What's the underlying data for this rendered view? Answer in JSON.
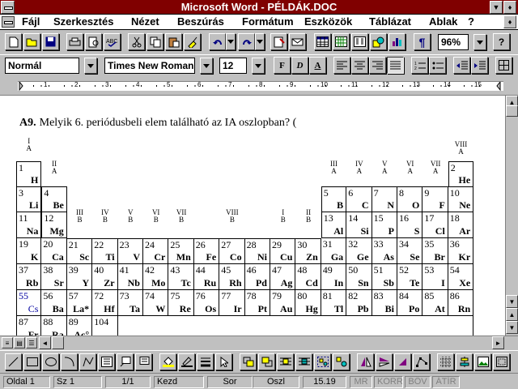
{
  "window": {
    "title": "Microsoft Word - PÉLDÁK.DOC"
  },
  "menu": [
    "Fájl",
    "Szerkesztés",
    "Nézet",
    "Beszúrás",
    "Formátum",
    "Eszközök",
    "Táblázat",
    "Ablak",
    "?"
  ],
  "toolbar": {
    "zoom": "96%"
  },
  "format": {
    "style": "Normál",
    "font": "Times New Roman",
    "size": "12",
    "bold": "F",
    "italic": "D",
    "underline": "A"
  },
  "ruler": {
    "labels": [
      "1",
      "2",
      "3",
      "4",
      "5",
      "6",
      "7",
      "8",
      "9",
      "10",
      "11",
      "12",
      "13",
      "14",
      "15"
    ]
  },
  "document": {
    "question_number": "A9.",
    "question_text": "Melyik  6. periódusbeli elem található az IA oszlopban? (",
    "group_labels": [
      {
        "top": "I",
        "bottom": "A"
      },
      {
        "top": "II",
        "bottom": "A"
      },
      {
        "top": "III",
        "bottom": "B"
      },
      {
        "top": "IV",
        "bottom": "B"
      },
      {
        "top": "V",
        "bottom": "B"
      },
      {
        "top": "VI",
        "bottom": "B"
      },
      {
        "top": "VII",
        "bottom": "B"
      },
      {
        "top": "VIII",
        "bottom": "B"
      },
      {
        "top": "I",
        "bottom": "B"
      },
      {
        "top": "II",
        "bottom": "B"
      },
      {
        "top": "III",
        "bottom": "A"
      },
      {
        "top": "IV",
        "bottom": "A"
      },
      {
        "top": "V",
        "bottom": "A"
      },
      {
        "top": "VI",
        "bottom": "A"
      },
      {
        "top": "VII",
        "bottom": "A"
      },
      {
        "top": "VIII",
        "bottom": "A"
      }
    ],
    "elements": [
      {
        "n": "1",
        "s": "H"
      },
      {
        "n": "2",
        "s": "He"
      },
      {
        "n": "3",
        "s": "Li"
      },
      {
        "n": "4",
        "s": "Be"
      },
      {
        "n": "5",
        "s": "B"
      },
      {
        "n": "6",
        "s": "C"
      },
      {
        "n": "7",
        "s": "N"
      },
      {
        "n": "8",
        "s": "O"
      },
      {
        "n": "9",
        "s": "F"
      },
      {
        "n": "10",
        "s": "Ne"
      },
      {
        "n": "11",
        "s": "Na"
      },
      {
        "n": "12",
        "s": "Mg"
      },
      {
        "n": "13",
        "s": "Al"
      },
      {
        "n": "14",
        "s": "Si"
      },
      {
        "n": "15",
        "s": "P"
      },
      {
        "n": "16",
        "s": "S"
      },
      {
        "n": "17",
        "s": "Cl"
      },
      {
        "n": "18",
        "s": "Ar"
      },
      {
        "n": "19",
        "s": "K"
      },
      {
        "n": "20",
        "s": "Ca"
      },
      {
        "n": "21",
        "s": "Sc"
      },
      {
        "n": "22",
        "s": "Ti"
      },
      {
        "n": "23",
        "s": "V"
      },
      {
        "n": "24",
        "s": "Cr"
      },
      {
        "n": "25",
        "s": "Mn"
      },
      {
        "n": "26",
        "s": "Fe"
      },
      {
        "n": "27",
        "s": "Co"
      },
      {
        "n": "28",
        "s": "Ni"
      },
      {
        "n": "29",
        "s": "Cu"
      },
      {
        "n": "30",
        "s": "Zn"
      },
      {
        "n": "31",
        "s": "Ga"
      },
      {
        "n": "32",
        "s": "Ge"
      },
      {
        "n": "33",
        "s": "As"
      },
      {
        "n": "34",
        "s": "Se"
      },
      {
        "n": "35",
        "s": "Br"
      },
      {
        "n": "36",
        "s": "Kr"
      },
      {
        "n": "37",
        "s": "Rb"
      },
      {
        "n": "38",
        "s": "Sr"
      },
      {
        "n": "39",
        "s": "Y"
      },
      {
        "n": "40",
        "s": "Zr"
      },
      {
        "n": "41",
        "s": "Nb"
      },
      {
        "n": "42",
        "s": "Mo"
      },
      {
        "n": "43",
        "s": "Tc"
      },
      {
        "n": "44",
        "s": "Ru"
      },
      {
        "n": "45",
        "s": "Rh"
      },
      {
        "n": "46",
        "s": "Pd"
      },
      {
        "n": "47",
        "s": "Ag"
      },
      {
        "n": "48",
        "s": "Cd"
      },
      {
        "n": "49",
        "s": "In"
      },
      {
        "n": "50",
        "s": "Sn"
      },
      {
        "n": "51",
        "s": "Sb"
      },
      {
        "n": "52",
        "s": "Te"
      },
      {
        "n": "53",
        "s": "I"
      },
      {
        "n": "54",
        "s": "Xe"
      },
      {
        "n": "55",
        "s": "Cs"
      },
      {
        "n": "56",
        "s": "Ba"
      },
      {
        "n": "57",
        "s": "La*"
      },
      {
        "n": "72",
        "s": "Hf"
      },
      {
        "n": "73",
        "s": "Ta"
      },
      {
        "n": "74",
        "s": "W"
      },
      {
        "n": "75",
        "s": "Re"
      },
      {
        "n": "76",
        "s": "Os"
      },
      {
        "n": "77",
        "s": "Ir"
      },
      {
        "n": "78",
        "s": "Pt"
      },
      {
        "n": "79",
        "s": "Au"
      },
      {
        "n": "80",
        "s": "Hg"
      },
      {
        "n": "81",
        "s": "Tl"
      },
      {
        "n": "82",
        "s": "Pb"
      },
      {
        "n": "83",
        "s": "Bi"
      },
      {
        "n": "84",
        "s": "Po"
      },
      {
        "n": "85",
        "s": "At"
      },
      {
        "n": "86",
        "s": "Rn"
      },
      {
        "n": "87",
        "s": "Fr"
      },
      {
        "n": "88",
        "s": "Ra"
      },
      {
        "n": "89",
        "s": "Ac°"
      },
      {
        "n": "104",
        "s": ""
      }
    ],
    "highlight_color": "#0000a0"
  },
  "status": {
    "page": "Oldal 1",
    "section": "Sz 1",
    "pages": "1/1",
    "at": "Kezd",
    "line": "Sor",
    "col": "Oszl",
    "time": "15.19",
    "mr": "MR",
    "korr": "KORR",
    "bov": "BÖV",
    "atir": "ÁTÍR"
  },
  "colors": {
    "titlebar": "#800000",
    "face": "#c0c0c0"
  }
}
